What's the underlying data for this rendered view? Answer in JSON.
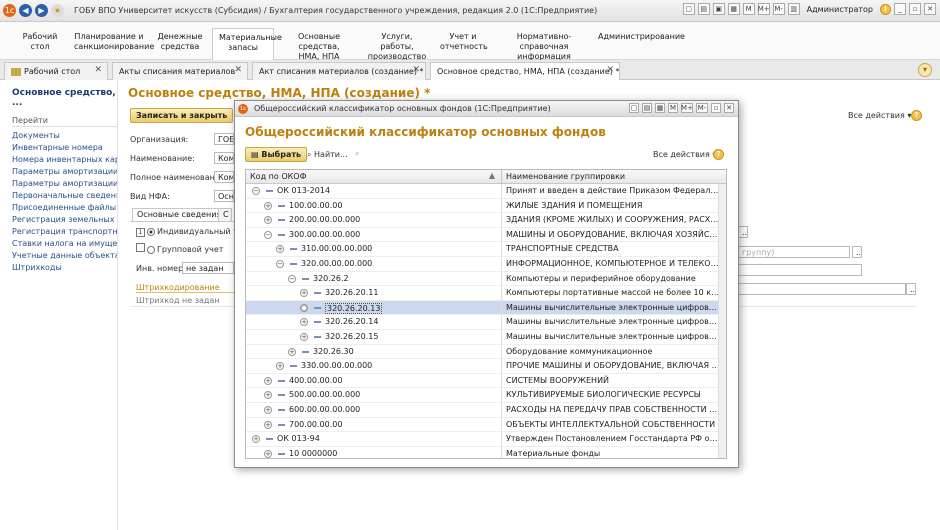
{
  "window": {
    "title": "ГОБУ ВПО Университет искусств (Субсидия) / Бухгалтерия государственного учреждения, редакция 2.0  (1С:Предприятие)",
    "toolbar_icons": [
      "M",
      "M+",
      "M-"
    ],
    "user": "Администратор"
  },
  "menu": [
    {
      "label": "Рабочий\nстол"
    },
    {
      "label": "Планирование и\nсанкционирование"
    },
    {
      "label": "Денежные\nсредства"
    },
    {
      "label": "Материальные\nзапасы"
    },
    {
      "label": "Основные средства,\nНМА, НПА"
    },
    {
      "label": "Услуги, работы,\nпроизводство"
    },
    {
      "label": "Учет и\nотчетность"
    },
    {
      "label": "Нормативно-справочная\nинформация"
    },
    {
      "label": "Администрирование"
    }
  ],
  "tabs": [
    {
      "label": "Рабочий стол"
    },
    {
      "label": "Акты списания материалов"
    },
    {
      "label": "Акт списания материалов (создание) *"
    },
    {
      "label": "Основное средство, НМА, НПА (создание) *"
    }
  ],
  "left_panel": {
    "title": "Основное средство, ...",
    "section": "Перейти",
    "links": [
      "Документы",
      "Инвентарные номера",
      "Номера инвентарных кар...",
      "Параметры амортизации ...",
      "Параметры амортизации ...",
      "Первоначальные сведени...",
      "Присоединенные файлы",
      "Регистрация земельных у...",
      "Регистрация транспортны...",
      "Ставки налога на имущес...",
      "Учетные данные объекта ...",
      "Штрихкоды"
    ]
  },
  "form": {
    "title": "Основное средство, НМА, НПА (создание) *",
    "save_close": "Записать и закрыть",
    "all_actions": "Все действия",
    "org_label": "Организация:",
    "org_value": "ГОБУ",
    "name_label": "Наименование:",
    "name_value": "Комп",
    "fullname_label": "Полное наименование:",
    "fullname_value": "Комп",
    "nfa_label": "Вид НФА:",
    "nfa_value": "Осно",
    "subtab_main": "Основные сведения",
    "opt_individual": "Индивидуальный учет",
    "opt_group": "Групповой учет",
    "inv_label": "Инв. номер:",
    "inv_value": "не задан",
    "barcode_section": "Штрихкодирование",
    "barcode_text": "Штрихкод не задан",
    "right_placeholder": "группу)"
  },
  "dialog": {
    "window_title": "Общероссийский классификатор основных фондов  (1С:Предприятие)",
    "heading": "Общероссийский классификатор основных фондов",
    "select_btn": "Выбрать",
    "find_btn": "Найти...",
    "all_actions": "Все действия",
    "col_code": "Код по ОКОФ",
    "col_name": "Наименование группировки",
    "rows": [
      {
        "code": "ОК 013-2014",
        "name": "Принят и введен в действие Приказом Федерального а...",
        "level": 0,
        "exp": "−"
      },
      {
        "code": "100.00.00.00",
        "name": "ЖИЛЫЕ ЗДАНИЯ И ПОМЕЩЕНИЯ",
        "level": 1,
        "exp": "+"
      },
      {
        "code": "200.00.00.00.000",
        "name": "ЗДАНИЯ (КРОМЕ ЖИЛЫХ) И СООРУЖЕНИЯ, РАСХОД...",
        "level": 1,
        "exp": "+"
      },
      {
        "code": "300.00.00.00.000",
        "name": "МАШИНЫ И ОБОРУДОВАНИЕ, ВКЛЮЧАЯ ХОЗЯЙСТВЕ...",
        "level": 1,
        "exp": "−"
      },
      {
        "code": "310.00.00.00.000",
        "name": "ТРАНСПОРТНЫЕ СРЕДСТВА",
        "level": 2,
        "exp": "+"
      },
      {
        "code": "320.00.00.00.000",
        "name": "ИНФОРМАЦИОННОЕ, КОМПЬЮТЕРНОЕ И ТЕЛЕКОММ...",
        "level": 2,
        "exp": "−"
      },
      {
        "code": "320.26.2",
        "name": "Компьютеры и периферийное оборудование",
        "level": 3,
        "exp": "−"
      },
      {
        "code": "320.26.20.11",
        "name": "Компьютеры портативные массой не более 10 кг, такие...",
        "level": 4,
        "exp": "+"
      },
      {
        "code": "320.26.20.13",
        "name": "Машины вычислительные электронные цифровые, соде...",
        "level": 4,
        "exp": "○",
        "selected": true
      },
      {
        "code": "320.26.20.14",
        "name": "Машины вычислительные электронные цифровые, пост...",
        "level": 4,
        "exp": "+"
      },
      {
        "code": "320.26.20.15",
        "name": "Машины вычислительные электронные цифровые прочи...",
        "level": 4,
        "exp": "+"
      },
      {
        "code": "320.26.30",
        "name": "Оборудование коммуникационное",
        "level": 3,
        "exp": "+"
      },
      {
        "code": "330.00.00.00.000",
        "name": "ПРОЧИЕ МАШИНЫ И ОБОРУДОВАНИЕ, ВКЛЮЧАЯ ХО...",
        "level": 2,
        "exp": "+"
      },
      {
        "code": "400.00.00.00",
        "name": "СИСТЕМЫ ВООРУЖЕНИЙ",
        "level": 1,
        "exp": "+"
      },
      {
        "code": "500.00.00.00.000",
        "name": "КУЛЬТИВИРУЕМЫЕ БИОЛОГИЧЕСКИЕ РЕСУРСЫ",
        "level": 1,
        "exp": "+"
      },
      {
        "code": "600.00.00.00.000",
        "name": "РАСХОДЫ НА ПЕРЕДАЧУ ПРАВ СОБСТВЕННОСТИ НА ...",
        "level": 1,
        "exp": "+"
      },
      {
        "code": "700.00.00.00",
        "name": "ОБЪЕКТЫ ИНТЕЛЛЕКТУАЛЬНОЙ СОБСТВЕННОСТИ",
        "level": 1,
        "exp": "+"
      },
      {
        "code": "ОК 013-94",
        "name": "Утвержден Постановлением Госстандарта РФ от 26 де...",
        "level": 0,
        "exp": "+"
      },
      {
        "code": "10 0000000",
        "name": "Материальные фонды",
        "level": 1,
        "exp": "+"
      }
    ]
  }
}
